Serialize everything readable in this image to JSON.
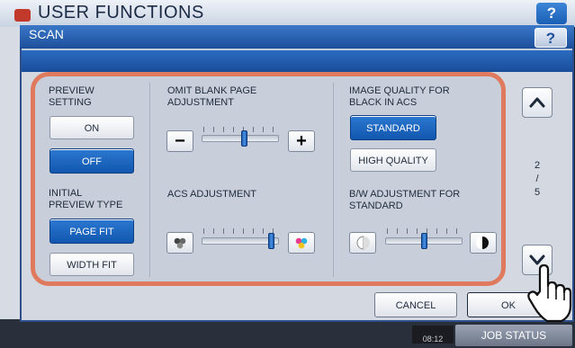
{
  "background": {
    "title": "USER FUNCTIONS",
    "help_label": "?",
    "clock": "08:12",
    "job_status_label": "JOB STATUS"
  },
  "dialog": {
    "title": "SCAN",
    "help_label": "?"
  },
  "preview": {
    "heading_line1": "PREVIEW",
    "heading_line2": "SETTING",
    "on_label": "ON",
    "off_label": "OFF",
    "selected": "OFF"
  },
  "initial_preview": {
    "heading_line1": "INITIAL",
    "heading_line2": "PREVIEW TYPE",
    "page_fit_label": "PAGE FIT",
    "width_fit_label": "WIDTH FIT",
    "selected": "PAGE FIT"
  },
  "omit_blank": {
    "heading_line1": "OMIT BLANK PAGE",
    "heading_line2": "ADJUSTMENT",
    "minus_label": "−",
    "plus_label": "+",
    "level": 0.55
  },
  "acs_adjustment": {
    "heading": "ACS ADJUSTMENT",
    "level": 0.9
  },
  "image_quality": {
    "heading_line1": "IMAGE QUALITY FOR",
    "heading_line2": "BLACK IN ACS",
    "standard_label": "STANDARD",
    "high_quality_label": "HIGH QUALITY",
    "selected": "STANDARD"
  },
  "bw_adjustment": {
    "heading_line1": "B/W ADJUSTMENT FOR",
    "heading_line2": "STANDARD",
    "level": 0.5
  },
  "pager": {
    "current": "2",
    "separator": "/",
    "total": "5"
  },
  "footer": {
    "cancel_label": "CANCEL",
    "ok_label": "OK"
  },
  "colors": {
    "highlight": "#e07a5f",
    "selected_button": "#1a64c0",
    "title_bar": "#1d4f9a"
  }
}
